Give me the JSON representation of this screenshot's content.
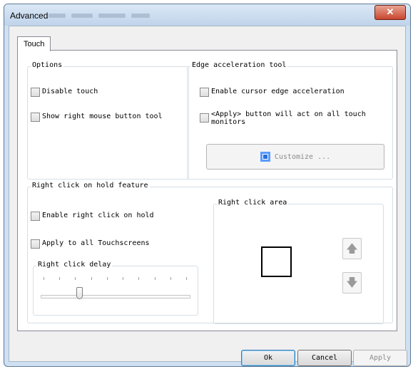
{
  "window": {
    "title": "Advanced",
    "close_glyph": "✕"
  },
  "tabs": [
    {
      "label": "Touch"
    }
  ],
  "options": {
    "label": "Options",
    "disable_touch": "Disable touch",
    "show_right_mouse": "Show right mouse button tool"
  },
  "edge": {
    "label": "Edge acceleration tool",
    "enable_edge": "Enable cursor edge acceleration",
    "apply_line1": "<Apply> button will act on all touch",
    "apply_line2": "monitors",
    "customize": "Customize ..."
  },
  "right_click": {
    "label": "Right click on hold feature",
    "enable": "Enable right click on hold",
    "apply_all": "Apply to all Touchscreens",
    "delay_label": "Right click delay",
    "delay_level": 0.25,
    "area_label": "Right click area",
    "up_icon": "arrow-up-icon",
    "down_icon": "arrow-down-icon"
  },
  "buttons": {
    "ok": "Ok",
    "cancel": "Cancel",
    "apply": "Apply"
  }
}
